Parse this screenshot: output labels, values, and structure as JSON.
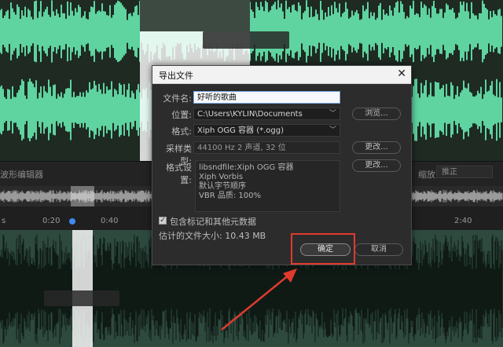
{
  "editor": {
    "label": "波形编辑器",
    "zoom_label": "缩放",
    "zoom_value": "推正",
    "ruler_ticks": [
      "s",
      "0:20",
      "0:40",
      "2:40"
    ],
    "wave_color": "#5fd3a0",
    "wave_dim_color": "#3c8d6a",
    "highlight_color": "#e03a2f"
  },
  "dialog": {
    "title": "导出文件",
    "filename_label": "文件名:",
    "filename_value": "好听的歌曲",
    "location_label": "位置:",
    "location_value": "C:\\Users\\KYLIN\\Documents",
    "browse_button": "浏览...",
    "format_label": "格式:",
    "format_value": "Xiph OGG 容器 (*.ogg)",
    "sample_label": "采样类型:",
    "sample_value": "44100 Hz 2 声道, 32 位",
    "sample_change_button": "更改...",
    "format_settings_label": "格式设置:",
    "format_settings_lines": [
      "libsndfile:Xiph OGG 容器",
      "Xiph Vorbis",
      "默认字节顺序",
      "VBR 品质: 100%"
    ],
    "format_change_button": "更改...",
    "include_markers_label": "包含标记和其他元数据",
    "estimated_size_label": "估计的文件大小: 10.43 MB",
    "ok_button": "确定",
    "cancel_button": "取消",
    "close_icon": "close-icon"
  }
}
